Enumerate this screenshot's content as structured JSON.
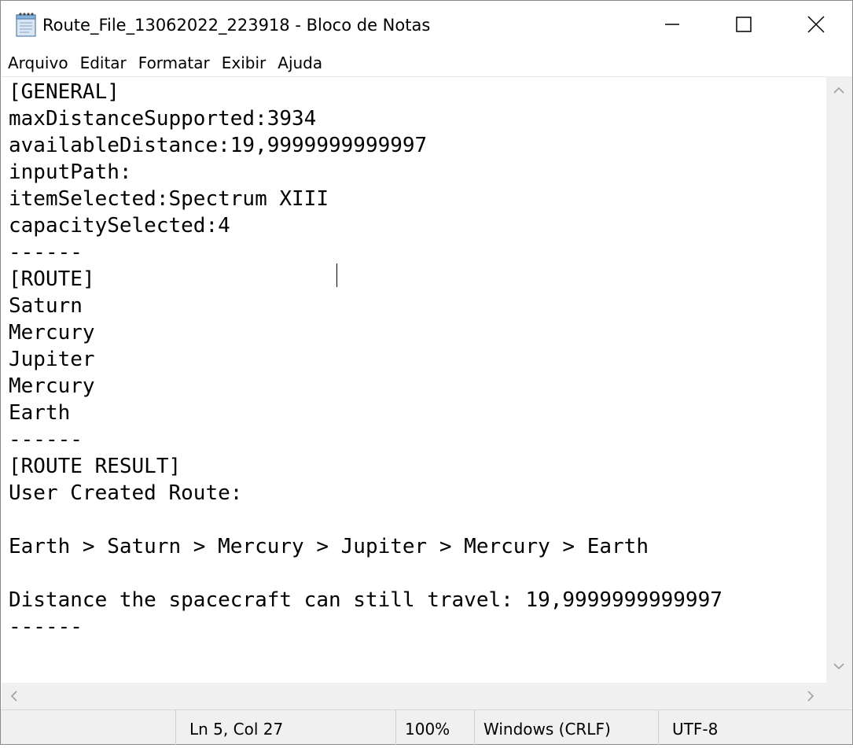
{
  "window": {
    "title": "Route_File_13062022_223918 - Bloco de Notas",
    "app_icon": "notepad-icon",
    "controls": {
      "minimize_icon": "minimize-icon",
      "maximize_icon": "maximize-icon",
      "close_icon": "close-icon"
    }
  },
  "menu": {
    "items": [
      "Arquivo",
      "Editar",
      "Formatar",
      "Exibir",
      "Ajuda"
    ]
  },
  "editor": {
    "lines": [
      "[GENERAL]",
      "maxDistanceSupported:3934",
      "availableDistance:19,9999999999997",
      "inputPath:",
      "itemSelected:Spectrum XIII",
      "capacitySelected:4",
      "------",
      "[ROUTE]",
      "Saturn",
      "Mercury",
      "Jupiter",
      "Mercury",
      "Earth",
      "------",
      "[ROUTE RESULT]",
      "User Created Route:",
      "",
      "Earth > Saturn > Mercury > Jupiter > Mercury > Earth",
      "",
      "Distance the spacecraft can still travel: 19,9999999999997",
      "------"
    ]
  },
  "statusbar": {
    "position": "Ln 5, Col 27",
    "zoom": "100%",
    "line_ending": "Windows (CRLF)",
    "encoding": "UTF-8"
  },
  "colors": {
    "chrome_background": "#f0f0f0",
    "editor_background": "#ffffff",
    "text": "#000000"
  }
}
